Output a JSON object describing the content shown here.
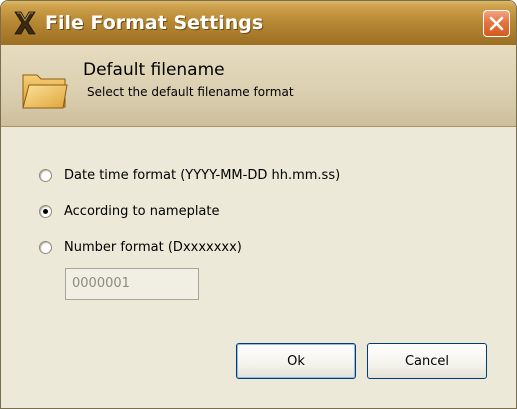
{
  "window": {
    "title": "File Format Settings"
  },
  "header": {
    "title": "Default filename",
    "subtitle": "Select the default filename format"
  },
  "options": [
    {
      "label": "Date time format (YYYY-MM-DD hh.mm.ss)",
      "selected": false
    },
    {
      "label": "According to nameplate",
      "selected": true
    },
    {
      "label": "Number format (Dxxxxxxx)",
      "selected": false
    }
  ],
  "number_field": {
    "value": "0000001",
    "enabled": false
  },
  "buttons": {
    "ok_label": "Ok",
    "cancel_label": "Cancel"
  },
  "icons": {
    "app": "app-x-icon",
    "close": "close-icon",
    "folder": "folder-icon"
  },
  "colors": {
    "titlebar": "#b98a35",
    "close_button": "#e4753f",
    "dialog_background": "#ece9d8",
    "header_band": "#dcd0b2"
  }
}
